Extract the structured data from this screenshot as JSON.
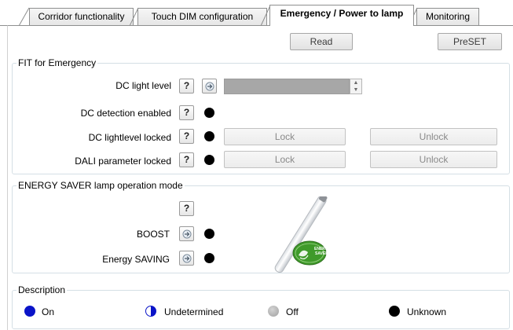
{
  "tabs": [
    {
      "label": "Corridor functionality",
      "active": false
    },
    {
      "label": "Touch DIM configuration",
      "active": false
    },
    {
      "label": "Emergency / Power to lamp",
      "active": true
    },
    {
      "label": "Monitoring",
      "active": false
    }
  ],
  "toolbar": {
    "read_label": "Read",
    "preset_label": "PreSET"
  },
  "fit_group": {
    "title": "FIT for Emergency",
    "dc_light_level_label": "DC light level",
    "dc_detection_label": "DC detection enabled",
    "dc_lightlevel_locked_label": "DC lightlevel locked",
    "dali_parameter_locked_label": "DALI parameter locked",
    "help_label": "?",
    "lock_label": "Lock",
    "unlock_label": "Unlock"
  },
  "energy_group": {
    "title": "ENERGY SAVER lamp operation mode",
    "help_label": "?",
    "boost_label": "BOOST",
    "energy_saving_label": "Energy SAVING",
    "badge_line1": "ENERGY",
    "badge_line2": "SAVER"
  },
  "description_group": {
    "title": "Description",
    "items": [
      {
        "label": "On",
        "state": "on"
      },
      {
        "label": "Undetermined",
        "state": "undetermined"
      },
      {
        "label": "Off",
        "state": "off"
      },
      {
        "label": "Unknown",
        "state": "unknown"
      }
    ]
  },
  "colors": {
    "on": "#0a14c8",
    "off": "#a8a8a8",
    "unknown": "#000000",
    "badge_green": "#3f9a2a"
  },
  "icons": {
    "help": "question-mark",
    "arrow": "arrow-right-icon",
    "spin_up": "triangle-up",
    "spin_down": "triangle-down"
  }
}
